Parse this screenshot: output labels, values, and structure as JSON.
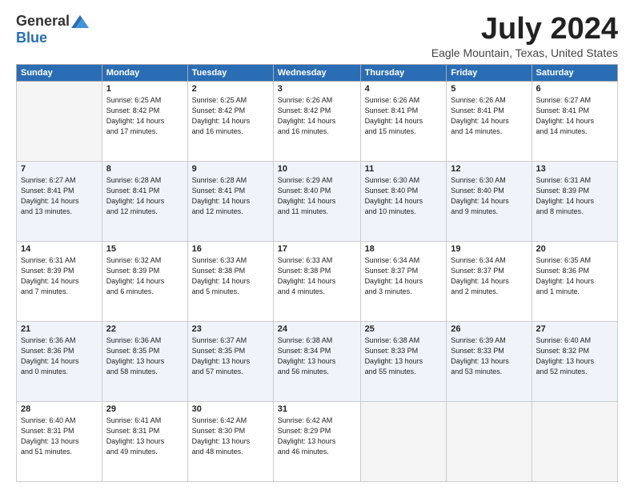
{
  "header": {
    "logo_general": "General",
    "logo_blue": "Blue",
    "month_title": "July 2024",
    "location": "Eagle Mountain, Texas, United States"
  },
  "days_of_week": [
    "Sunday",
    "Monday",
    "Tuesday",
    "Wednesday",
    "Thursday",
    "Friday",
    "Saturday"
  ],
  "weeks": [
    [
      {
        "day": "",
        "info": ""
      },
      {
        "day": "1",
        "info": "Sunrise: 6:25 AM\nSunset: 8:42 PM\nDaylight: 14 hours\nand 17 minutes."
      },
      {
        "day": "2",
        "info": "Sunrise: 6:25 AM\nSunset: 8:42 PM\nDaylight: 14 hours\nand 16 minutes."
      },
      {
        "day": "3",
        "info": "Sunrise: 6:26 AM\nSunset: 8:42 PM\nDaylight: 14 hours\nand 16 minutes."
      },
      {
        "day": "4",
        "info": "Sunrise: 6:26 AM\nSunset: 8:41 PM\nDaylight: 14 hours\nand 15 minutes."
      },
      {
        "day": "5",
        "info": "Sunrise: 6:26 AM\nSunset: 8:41 PM\nDaylight: 14 hours\nand 14 minutes."
      },
      {
        "day": "6",
        "info": "Sunrise: 6:27 AM\nSunset: 8:41 PM\nDaylight: 14 hours\nand 14 minutes."
      }
    ],
    [
      {
        "day": "7",
        "info": "Sunrise: 6:27 AM\nSunset: 8:41 PM\nDaylight: 14 hours\nand 13 minutes."
      },
      {
        "day": "8",
        "info": "Sunrise: 6:28 AM\nSunset: 8:41 PM\nDaylight: 14 hours\nand 12 minutes."
      },
      {
        "day": "9",
        "info": "Sunrise: 6:28 AM\nSunset: 8:41 PM\nDaylight: 14 hours\nand 12 minutes."
      },
      {
        "day": "10",
        "info": "Sunrise: 6:29 AM\nSunset: 8:40 PM\nDaylight: 14 hours\nand 11 minutes."
      },
      {
        "day": "11",
        "info": "Sunrise: 6:30 AM\nSunset: 8:40 PM\nDaylight: 14 hours\nand 10 minutes."
      },
      {
        "day": "12",
        "info": "Sunrise: 6:30 AM\nSunset: 8:40 PM\nDaylight: 14 hours\nand 9 minutes."
      },
      {
        "day": "13",
        "info": "Sunrise: 6:31 AM\nSunset: 8:39 PM\nDaylight: 14 hours\nand 8 minutes."
      }
    ],
    [
      {
        "day": "14",
        "info": "Sunrise: 6:31 AM\nSunset: 8:39 PM\nDaylight: 14 hours\nand 7 minutes."
      },
      {
        "day": "15",
        "info": "Sunrise: 6:32 AM\nSunset: 8:39 PM\nDaylight: 14 hours\nand 6 minutes."
      },
      {
        "day": "16",
        "info": "Sunrise: 6:33 AM\nSunset: 8:38 PM\nDaylight: 14 hours\nand 5 minutes."
      },
      {
        "day": "17",
        "info": "Sunrise: 6:33 AM\nSunset: 8:38 PM\nDaylight: 14 hours\nand 4 minutes."
      },
      {
        "day": "18",
        "info": "Sunrise: 6:34 AM\nSunset: 8:37 PM\nDaylight: 14 hours\nand 3 minutes."
      },
      {
        "day": "19",
        "info": "Sunrise: 6:34 AM\nSunset: 8:37 PM\nDaylight: 14 hours\nand 2 minutes."
      },
      {
        "day": "20",
        "info": "Sunrise: 6:35 AM\nSunset: 8:36 PM\nDaylight: 14 hours\nand 1 minute."
      }
    ],
    [
      {
        "day": "21",
        "info": "Sunrise: 6:36 AM\nSunset: 8:36 PM\nDaylight: 14 hours\nand 0 minutes."
      },
      {
        "day": "22",
        "info": "Sunrise: 6:36 AM\nSunset: 8:35 PM\nDaylight: 13 hours\nand 58 minutes."
      },
      {
        "day": "23",
        "info": "Sunrise: 6:37 AM\nSunset: 8:35 PM\nDaylight: 13 hours\nand 57 minutes."
      },
      {
        "day": "24",
        "info": "Sunrise: 6:38 AM\nSunset: 8:34 PM\nDaylight: 13 hours\nand 56 minutes."
      },
      {
        "day": "25",
        "info": "Sunrise: 6:38 AM\nSunset: 8:33 PM\nDaylight: 13 hours\nand 55 minutes."
      },
      {
        "day": "26",
        "info": "Sunrise: 6:39 AM\nSunset: 8:33 PM\nDaylight: 13 hours\nand 53 minutes."
      },
      {
        "day": "27",
        "info": "Sunrise: 6:40 AM\nSunset: 8:32 PM\nDaylight: 13 hours\nand 52 minutes."
      }
    ],
    [
      {
        "day": "28",
        "info": "Sunrise: 6:40 AM\nSunset: 8:31 PM\nDaylight: 13 hours\nand 51 minutes."
      },
      {
        "day": "29",
        "info": "Sunrise: 6:41 AM\nSunset: 8:31 PM\nDaylight: 13 hours\nand 49 minutes."
      },
      {
        "day": "30",
        "info": "Sunrise: 6:42 AM\nSunset: 8:30 PM\nDaylight: 13 hours\nand 48 minutes."
      },
      {
        "day": "31",
        "info": "Sunrise: 6:42 AM\nSunset: 8:29 PM\nDaylight: 13 hours\nand 46 minutes."
      },
      {
        "day": "",
        "info": ""
      },
      {
        "day": "",
        "info": ""
      },
      {
        "day": "",
        "info": ""
      }
    ]
  ]
}
